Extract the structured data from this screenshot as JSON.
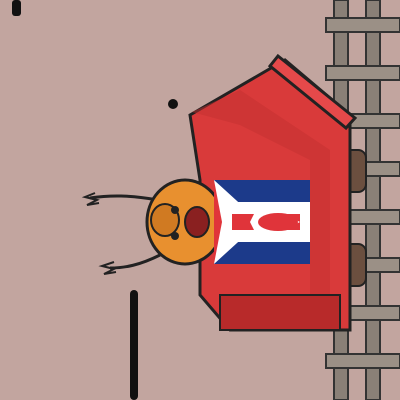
{
  "scene": {
    "background_color": "#c2a59f",
    "track_color": "#8a8077",
    "cart_color": "#d93a3a",
    "cart_roof_color": "#e5494a",
    "character_color": "#e8902f",
    "flag": {
      "top_color": "#1c3a8a",
      "bottom_color": "#1c3a8a",
      "triangle_color": "#ffffff",
      "stripe_color": "#e0343a"
    },
    "icons": [
      "rail-track",
      "mine-cart",
      "potato-character",
      "flag-emblem"
    ]
  }
}
